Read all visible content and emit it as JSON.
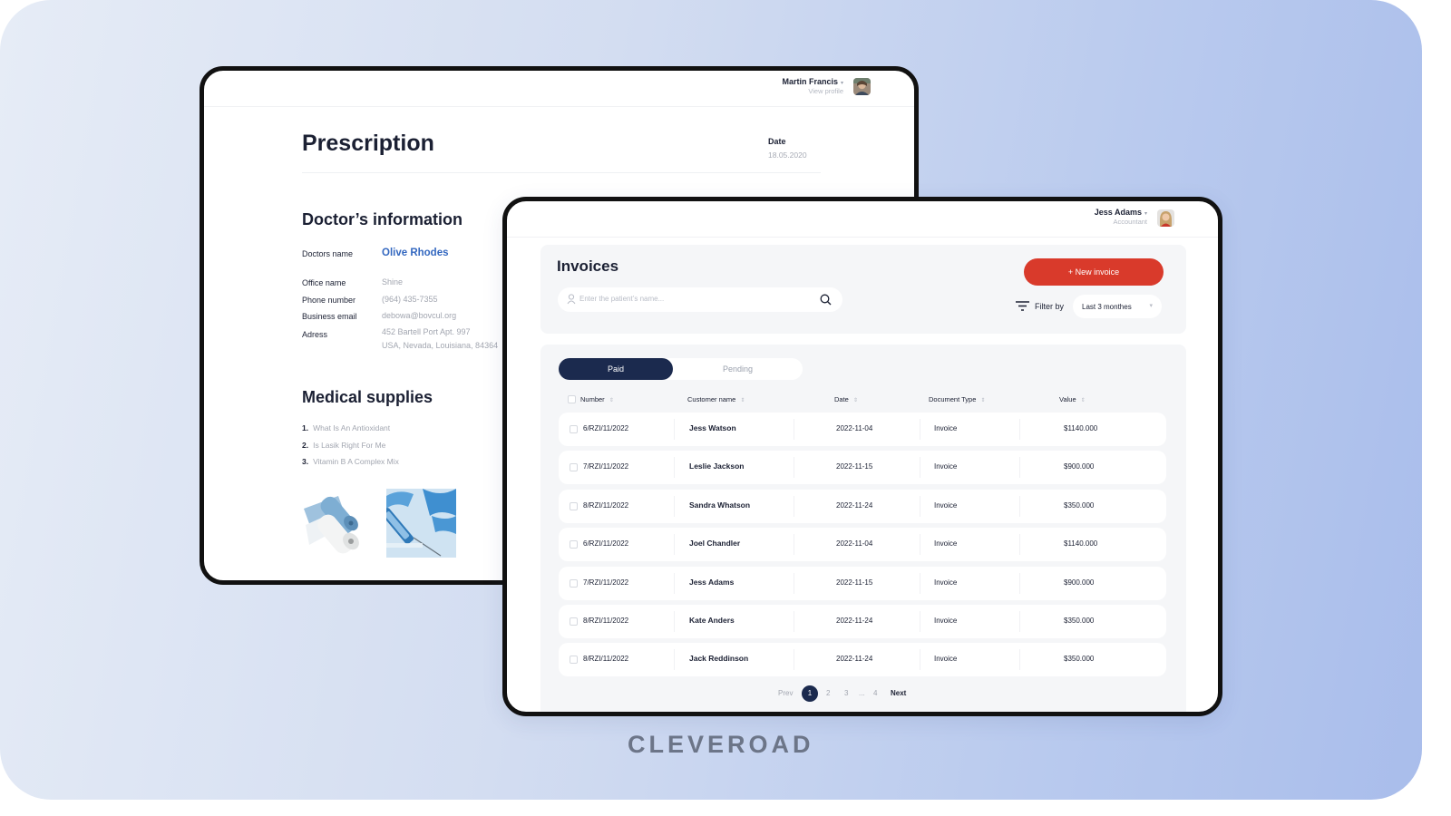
{
  "brand": "CLEVEROAD",
  "colors": {
    "accent_red": "#d93a2b",
    "navy": "#1b2a4e",
    "link_blue": "#3468c0",
    "background_start": "#e6ecf6",
    "background_end": "#a9bdeb"
  },
  "prescription": {
    "user": {
      "name": "Martin Francis",
      "caret": "▾",
      "subtitle": "View profile",
      "avatar_icon": "user-avatar"
    },
    "title": "Prescription",
    "date_label": "Date",
    "date_value": "18.05.2020",
    "doctor_section_title": "Doctor’s information",
    "doctor_name_label": "Doctors name",
    "doctor_name": "Olive Rhodes",
    "fields": [
      {
        "label": "Office name",
        "value": "Shine"
      },
      {
        "label": "Phone number",
        "value": "(964) 435-7355"
      },
      {
        "label": "Business email",
        "value": "debowa@bovcul.org"
      },
      {
        "label": "Adress",
        "value": "452 Bartell Port Apt. 997",
        "value2": "USA, Nevada, Louisiana, 84364"
      }
    ],
    "supplies_title": "Medical supplies",
    "supplies": [
      {
        "num": "1.",
        "name": "What Is An Antioxidant"
      },
      {
        "num": "2.",
        "name": "Is Lasik Right For Me"
      },
      {
        "num": "3.",
        "name": "Vitamin B A Complex Mix"
      }
    ],
    "images": [
      "paper-rolls-image",
      "syringe-image"
    ]
  },
  "invoices": {
    "user": {
      "name": "Jess Adams",
      "caret": "▾",
      "subtitle": "Accountant",
      "avatar_icon": "user-avatar"
    },
    "title": "Invoices",
    "search_placeholder": "Enter the patient’s name...",
    "new_button": "+ New invoice",
    "filter_label": "Filter by",
    "filter_value": "Last 3 monthes",
    "tabs": [
      {
        "label": "Paid",
        "active": true
      },
      {
        "label": "Pending",
        "active": false
      }
    ],
    "columns": [
      "Number",
      "Customer name",
      "Date",
      "Document Type",
      "Value"
    ],
    "sort_glyph": "⇕",
    "rows": [
      {
        "number": "6/RZI/11/2022",
        "customer": "Jess Watson",
        "date": "2022-11-04",
        "type": "Invoice",
        "value": "$1140.000"
      },
      {
        "number": "7/RZI/11/2022",
        "customer": "Leslie Jackson",
        "date": "2022-11-15",
        "type": "Invoice",
        "value": "$900.000"
      },
      {
        "number": "8/RZI/11/2022",
        "customer": "Sandra Whatson",
        "date": "2022-11-24",
        "type": "Invoice",
        "value": "$350.000"
      },
      {
        "number": "6/RZI/11/2022",
        "customer": "Joel Chandler",
        "date": "2022-11-04",
        "type": "Invoice",
        "value": "$1140.000"
      },
      {
        "number": "7/RZI/11/2022",
        "customer": "Jess Adams",
        "date": "2022-11-15",
        "type": "Invoice",
        "value": "$900.000"
      },
      {
        "number": "8/RZI/11/2022",
        "customer": "Kate Anders",
        "date": "2022-11-24",
        "type": "Invoice",
        "value": "$350.000"
      },
      {
        "number": "8/RZI/11/2022",
        "customer": "Jack Reddinson",
        "date": "2022-11-24",
        "type": "Invoice",
        "value": "$350.000"
      }
    ],
    "pagination": {
      "prev": "Prev",
      "pages": [
        "1",
        "2",
        "3",
        "...",
        "4"
      ],
      "current": "1",
      "next": "Next"
    }
  }
}
